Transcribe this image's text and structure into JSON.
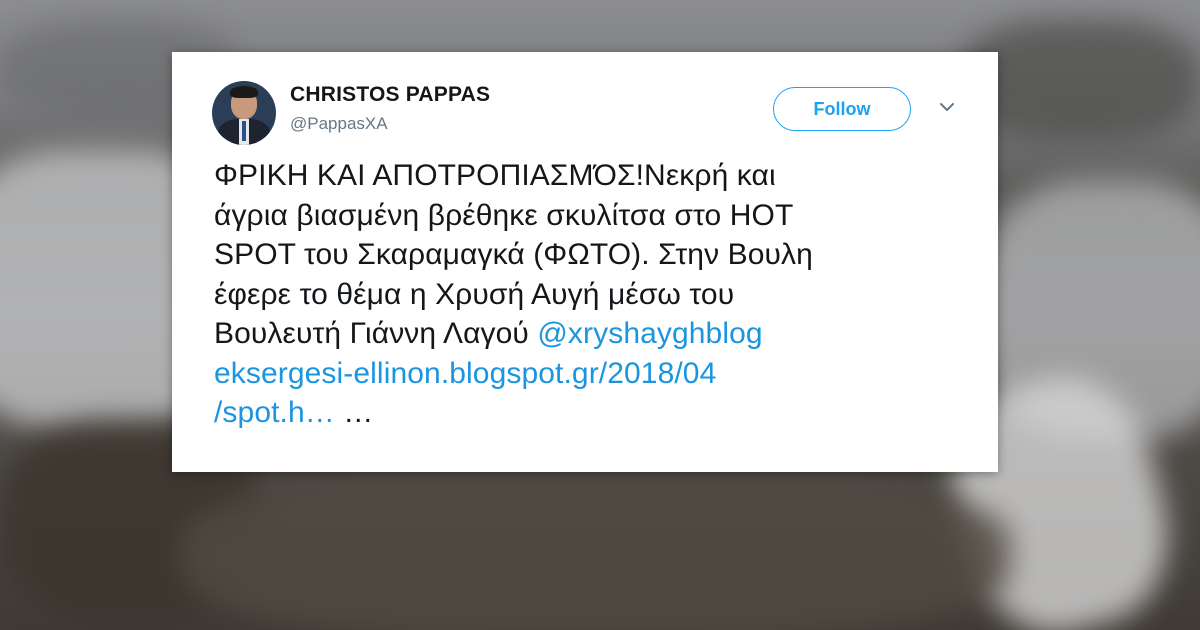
{
  "tweet": {
    "author_name": "CHRISTOS PAPPAS",
    "author_handle": "@PappasXA",
    "follow_label": "Follow",
    "lines": [
      "ΦΡΙΚΗ ΚΑΙ ΑΠΟΤΡΟΠΙΑΣΜΌΣ!Νεκρή και",
      "άγρια βιασμένη βρέθηκε σκυλίτσα στο HOT",
      "SPOT του Σκαραμαγκά (ΦΩΤΟ). Στην Βουλη",
      "έφερε το θέμα η Χρυσή Αυγή μέσω του"
    ],
    "line5_text": "Βουλευτή Γιάννη Λαγού ",
    "mention": "@xryshayghblog",
    "url_line1": "eksergesi-ellinon.blogspot.gr/2018/04",
    "url_line2": "/spot.h…",
    "ellipsis": " …"
  },
  "icons": {
    "menu": "chevron-down-icon",
    "avatar": "profile-photo"
  },
  "colors": {
    "accent": "#1da1f2",
    "link": "#1b95e0",
    "text": "#14171a",
    "secondary": "#657786"
  }
}
